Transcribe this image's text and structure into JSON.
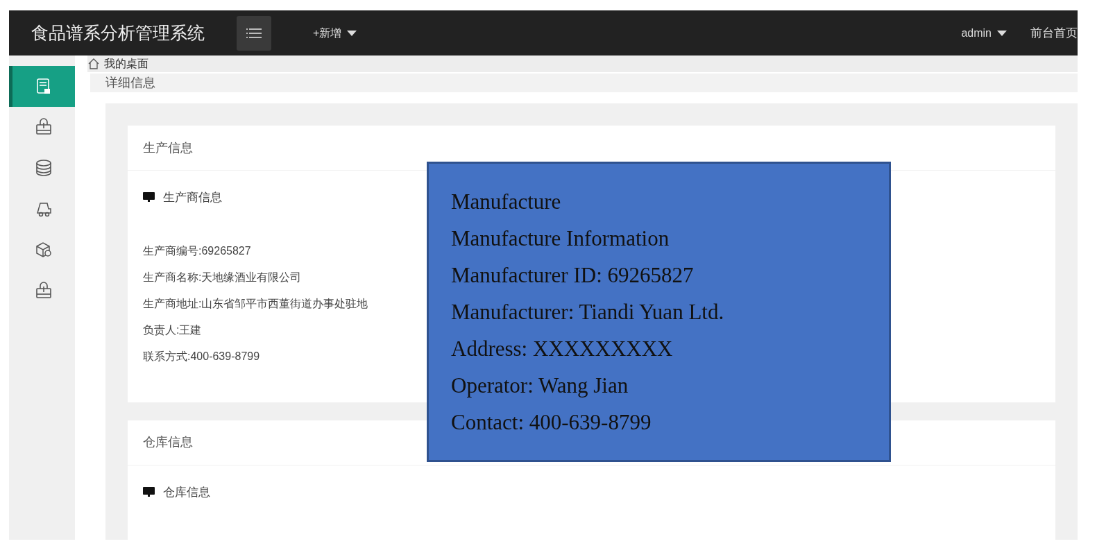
{
  "navbar": {
    "title": "食品谱系分析管理系统",
    "add_menu": "+新增",
    "user_menu": "admin",
    "front_link": "前台首页"
  },
  "sidebar": {
    "items": [
      {
        "selected": true
      },
      {
        "selected": false
      },
      {
        "selected": false
      },
      {
        "selected": false
      },
      {
        "selected": false
      },
      {
        "selected": false
      }
    ]
  },
  "breadcrumb": "我的桌面",
  "page_title": "详细信息",
  "sections": [
    {
      "title": "生产信息",
      "subtitle": "生产商信息",
      "lines": [
        "生产商编号:69265827",
        "生产商名称:天地缘酒业有限公司",
        "生产商地址:山东省邹平市西董街道办事处驻地",
        "负责人:王建",
        "联系方式:400-639-8799"
      ]
    },
    {
      "title": "仓库信息",
      "subtitle": "仓库信息"
    }
  ],
  "annotation": {
    "lines": [
      "Manufacture",
      "Manufacture Information",
      "Manufacturer ID: 69265827",
      "Manufacturer: Tiandi Yuan Ltd.",
      "Address: XXXXXXXXX",
      "Operator: Wang Jian",
      "Contact: 400-639-8799"
    ]
  }
}
